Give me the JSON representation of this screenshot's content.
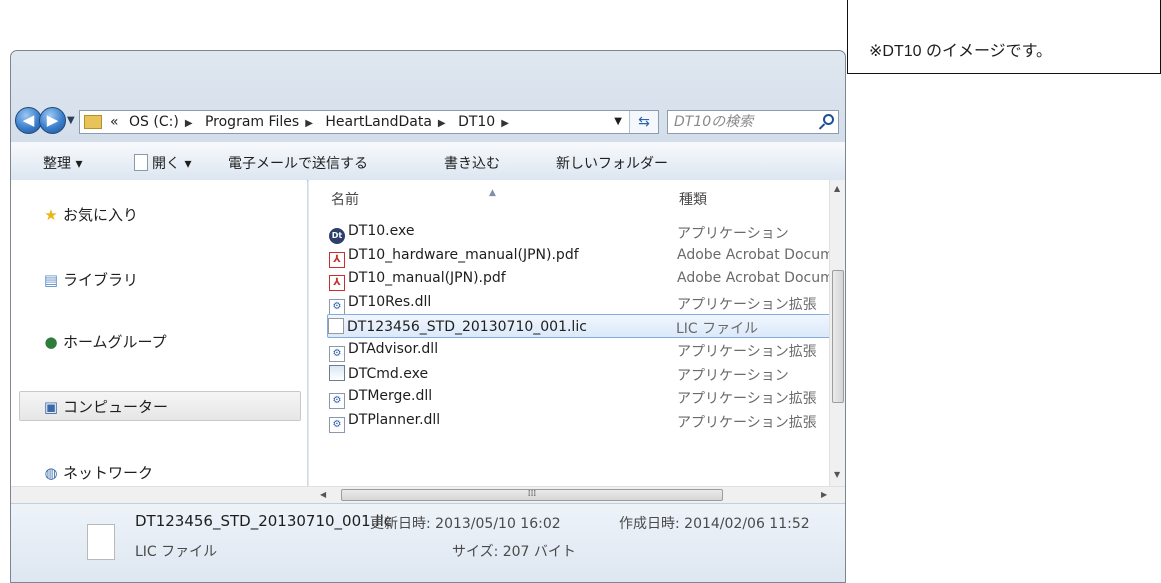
{
  "note": "※DT10 のイメージです。",
  "address": {
    "crumbs": [
      "«",
      "OS (C:)",
      "Program Files",
      "HeartLandData",
      "DT10"
    ],
    "search_placeholder": "DT10の検索"
  },
  "toolbar": {
    "organize": "整理 ▾",
    "open": "開く ▾",
    "email": "電子メールで送信する",
    "burn": "書き込む",
    "new_folder": "新しいフォルダー"
  },
  "nav": {
    "favorites": "お気に入り",
    "libraries": "ライブラリ",
    "homegroup": "ホームグループ",
    "computer": "コンピューター",
    "network": "ネットワーク"
  },
  "columns": {
    "name": "名前",
    "type": "種類"
  },
  "files": [
    {
      "name": "DT10.exe",
      "type": "アプリケーション",
      "icon": "exe"
    },
    {
      "name": "DT10_hardware_manual(JPN).pdf",
      "type": "Adobe Acrobat Document",
      "icon": "pdf"
    },
    {
      "name": "DT10_manual(JPN).pdf",
      "type": "Adobe Acrobat Document",
      "icon": "pdf"
    },
    {
      "name": "DT10Res.dll",
      "type": "アプリケーション拡張",
      "icon": "dll"
    },
    {
      "name": "DT123456_STD_20130710_001.lic",
      "type": "LIC ファイル",
      "icon": "lic"
    },
    {
      "name": "DTAdvisor.dll",
      "type": "アプリケーション拡張",
      "icon": "dll"
    },
    {
      "name": "DTCmd.exe",
      "type": "アプリケーション",
      "icon": "cmd"
    },
    {
      "name": "DTMerge.dll",
      "type": "アプリケーション拡張",
      "icon": "dll"
    },
    {
      "name": "DTPlanner.dll",
      "type": "アプリケーション拡張",
      "icon": "dll"
    }
  ],
  "selected_file_index": 4,
  "details": {
    "filename": "DT123456_STD_20130710_001.lic",
    "modified": "更新日時: 2013/05/10 16:02",
    "created": "作成日時: 2014/02/06 11:52",
    "filetype": "LIC ファイル",
    "size": "サイズ: 207 バイト"
  },
  "colors": {
    "selection_border": "#84acdd",
    "chrome": "#cfdae7"
  }
}
